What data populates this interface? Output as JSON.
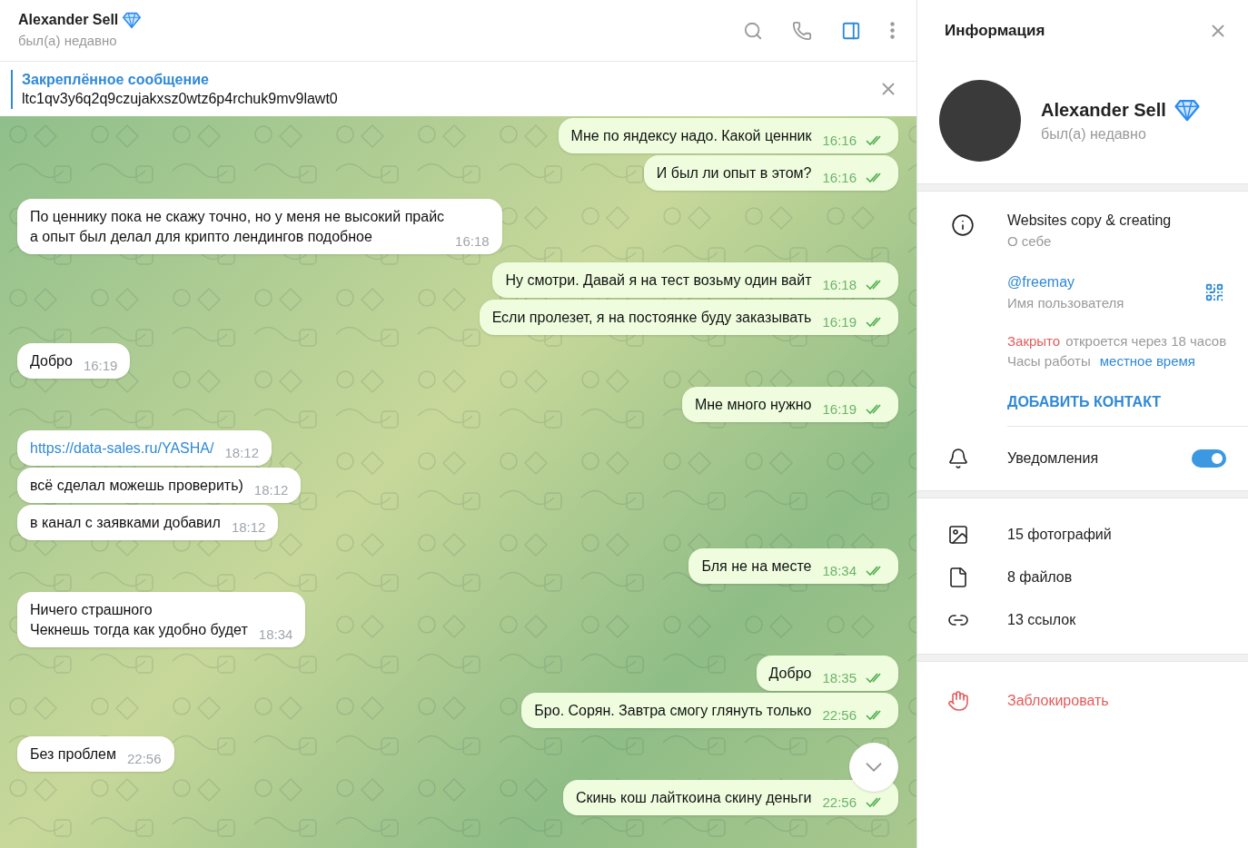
{
  "chat_header": {
    "name": "Alexander Sell",
    "status": "был(а) недавно",
    "premium": true
  },
  "pinned": {
    "title": "Закреплённое сообщение",
    "text": "ltc1qv3y6q2q9czujakxsz0wtz6p4rchuk9mv9lawt0"
  },
  "messages": [
    {
      "outgoing": true,
      "kind": "text",
      "lines": [
        "Мне по яндексу надо. Какой ценник"
      ],
      "time": "16:16",
      "read": true
    },
    {
      "outgoing": true,
      "kind": "text",
      "lines": [
        "И был ли опыт в этом?"
      ],
      "time": "16:16",
      "read": true
    },
    {
      "outgoing": false,
      "kind": "text",
      "lines": [
        "По ценнику пока не скажу точно, но у меня не высокий прайс",
        "а опыт был делал для крипто лендингов подобное"
      ],
      "time": "16:18"
    },
    {
      "outgoing": true,
      "kind": "text",
      "lines": [
        "Ну смотри. Давай я на тест возьму один вайт"
      ],
      "time": "16:18",
      "read": true
    },
    {
      "outgoing": true,
      "kind": "text",
      "lines": [
        "Если пролезет, я на постоянке буду заказывать"
      ],
      "time": "16:19",
      "read": true
    },
    {
      "outgoing": false,
      "kind": "text",
      "lines": [
        "Добро"
      ],
      "time": "16:19"
    },
    {
      "outgoing": true,
      "kind": "text",
      "lines": [
        "Мне много нужно"
      ],
      "time": "16:19",
      "read": true
    },
    {
      "outgoing": false,
      "kind": "link",
      "lines": [
        "https://data-sales.ru/YASHA/"
      ],
      "time": "18:12"
    },
    {
      "outgoing": false,
      "kind": "text",
      "lines": [
        "всё сделал можешь проверить)"
      ],
      "time": "18:12"
    },
    {
      "outgoing": false,
      "kind": "text",
      "lines": [
        "в канал с заявками добавил"
      ],
      "time": "18:12"
    },
    {
      "outgoing": true,
      "kind": "text",
      "lines": [
        "Бля не на месте"
      ],
      "time": "18:34",
      "read": true
    },
    {
      "outgoing": false,
      "kind": "text",
      "lines": [
        "Ничего страшного",
        "Чекнешь тогда как удобно будет"
      ],
      "time": "18:34"
    },
    {
      "outgoing": true,
      "kind": "text",
      "lines": [
        "Добро"
      ],
      "time": "18:35",
      "read": true
    },
    {
      "outgoing": true,
      "kind": "text",
      "lines": [
        "Бро. Сорян. Завтра смогу глянуть только"
      ],
      "time": "22:56",
      "read": true
    },
    {
      "outgoing": false,
      "kind": "text",
      "lines": [
        "Без проблем"
      ],
      "time": "22:56"
    },
    {
      "outgoing": true,
      "kind": "text",
      "lines": [
        "Скинь кош лайткоина скину деньги"
      ],
      "time": "22:56",
      "read": true
    }
  ],
  "info_panel": {
    "title": "Информация",
    "name": "Alexander Sell",
    "premium": true,
    "status": "был(а) недавно",
    "bio": "Websites copy & creating",
    "bio_label": "О себе",
    "username": "@freemay",
    "username_label": "Имя пользователя",
    "hours_status": "Закрыто",
    "hours_opens": "откроется через 18 часов",
    "hours_label": "Часы работы",
    "hours_link": "местное время",
    "add_contact": "ДОБАВИТЬ КОНТАКТ",
    "notifications": {
      "label": "Уведомления",
      "on": true
    },
    "media": [
      {
        "kind": "photos",
        "label": "15 фотографий"
      },
      {
        "kind": "files",
        "label": "8 файлов"
      },
      {
        "kind": "links",
        "label": "13 ссылок"
      }
    ],
    "block": "Заблокировать"
  }
}
